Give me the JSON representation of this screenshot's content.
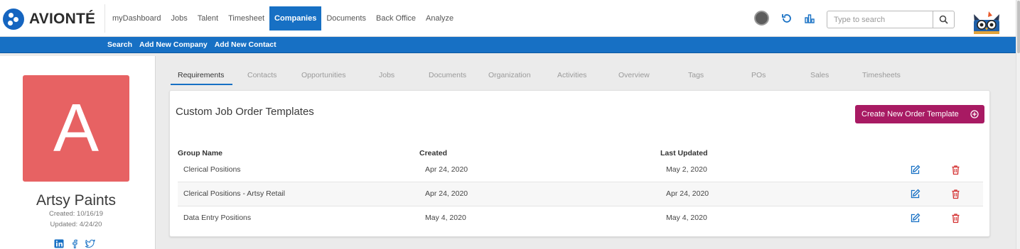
{
  "brand": {
    "name": "AVIONTÉ"
  },
  "nav": {
    "items": [
      "myDashboard",
      "Jobs",
      "Talent",
      "Timesheet",
      "Companies",
      "Documents",
      "Back Office",
      "Analyze"
    ],
    "active": "Companies"
  },
  "search": {
    "placeholder": "Type to search"
  },
  "subnav": {
    "items": [
      "Search",
      "Add New Company",
      "Add New Contact"
    ]
  },
  "company": {
    "initial": "A",
    "name": "Artsy Paints",
    "created": "Created: 10/16/19",
    "updated": "Updated: 4/24/20",
    "tile_color": "#e76263"
  },
  "tabs": {
    "items": [
      "Requirements",
      "Contacts",
      "Opportunities",
      "Jobs",
      "Documents",
      "Organization",
      "Activities",
      "Overview",
      "Tags",
      "POs",
      "Sales",
      "Timesheets"
    ],
    "active": "Requirements"
  },
  "templates": {
    "title": "Custom Job Order Templates",
    "create_label": "Create New Order Template",
    "columns": {
      "group": "Group Name",
      "created": "Created",
      "updated": "Last Updated"
    },
    "rows": [
      {
        "group": "Clerical Positions",
        "created": "Apr 24, 2020",
        "updated": "May 2, 2020"
      },
      {
        "group": "Clerical Positions - Artsy Retail",
        "created": "Apr 24, 2020",
        "updated": "Apr 24, 2020"
      },
      {
        "group": "Data Entry Positions",
        "created": "May 4, 2020",
        "updated": "May 4, 2020"
      }
    ]
  },
  "colors": {
    "primary": "#1770c4",
    "accent": "#a81a63",
    "delete": "#d32f2f",
    "edit": "#1770c4"
  },
  "icons": [
    "history-icon",
    "analytics-icon",
    "search-icon",
    "owl-mascot-icon",
    "linkedin-icon",
    "facebook-icon",
    "twitter-icon",
    "edit-icon",
    "delete-icon",
    "plus-circle-icon"
  ]
}
